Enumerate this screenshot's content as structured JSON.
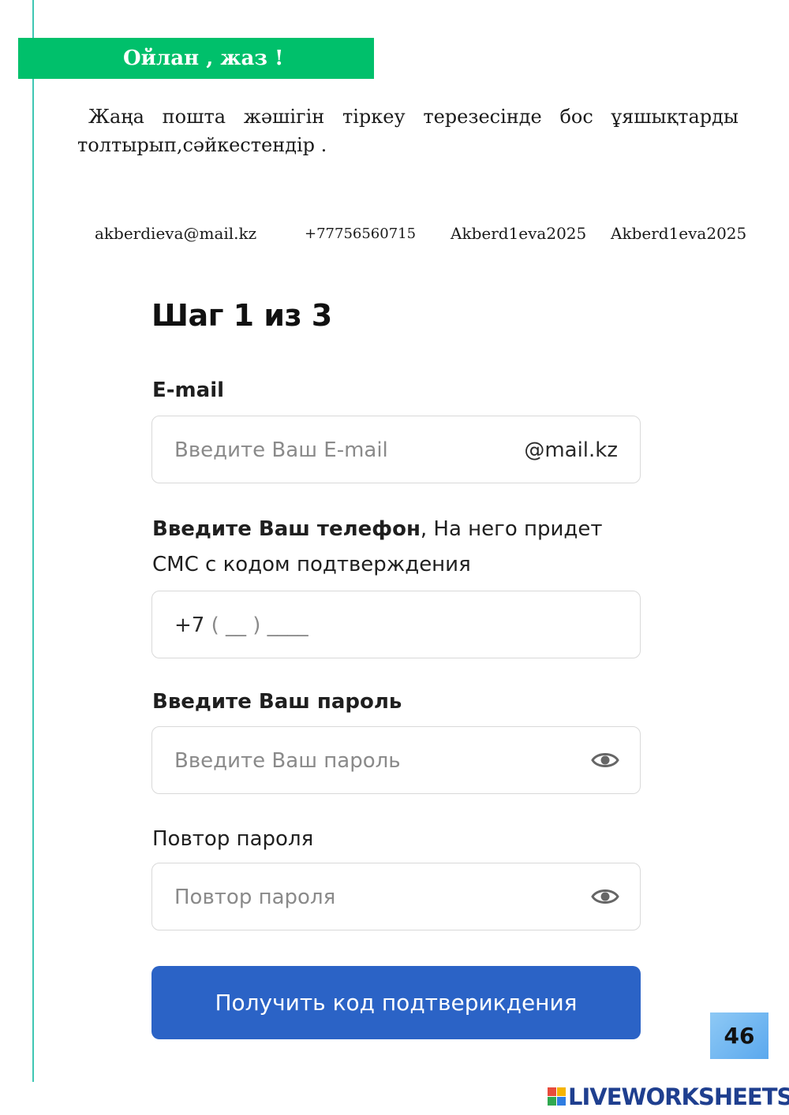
{
  "banner": {
    "title": "Ойлан , жаз !"
  },
  "instruction": "Жаңа пошта жәшігін тіркеу терезесінде бос ұяшықтарды толтырып,сәйкестендір .",
  "word_bank": [
    "akberdieva@mail.kz",
    "+77756560715",
    "Akberd1eva2025",
    "Akberd1eva2025"
  ],
  "form": {
    "title": "Шаг 1 из 3",
    "email": {
      "label": "E-mail",
      "placeholder": "Введите Ваш E-mail",
      "suffix": "@mail.kz"
    },
    "phone": {
      "label_bold": "Введите Ваш телефон",
      "label_rest": ", На него придет",
      "label_line2": "СМС с кодом подтверждения",
      "prefix": "+7",
      "mask": "( __ ) ____"
    },
    "password": {
      "label": "Введите Ваш пароль",
      "placeholder": "Введите Ваш пароль",
      "icon": "eye-icon"
    },
    "repeat": {
      "label": "Повтор пароля",
      "placeholder": "Повтор пароля",
      "icon": "eye-icon"
    },
    "submit_label": "Получить код подтверикдения"
  },
  "page_number": "46",
  "footer": {
    "brand": "LIVEWORKSHEETS"
  },
  "colors": {
    "banner": "#00c06b",
    "margin_line": "#3fc7b4",
    "button": "#2b63c6",
    "page_badge": "#6db5f0",
    "brand": "#1f3f8f"
  }
}
